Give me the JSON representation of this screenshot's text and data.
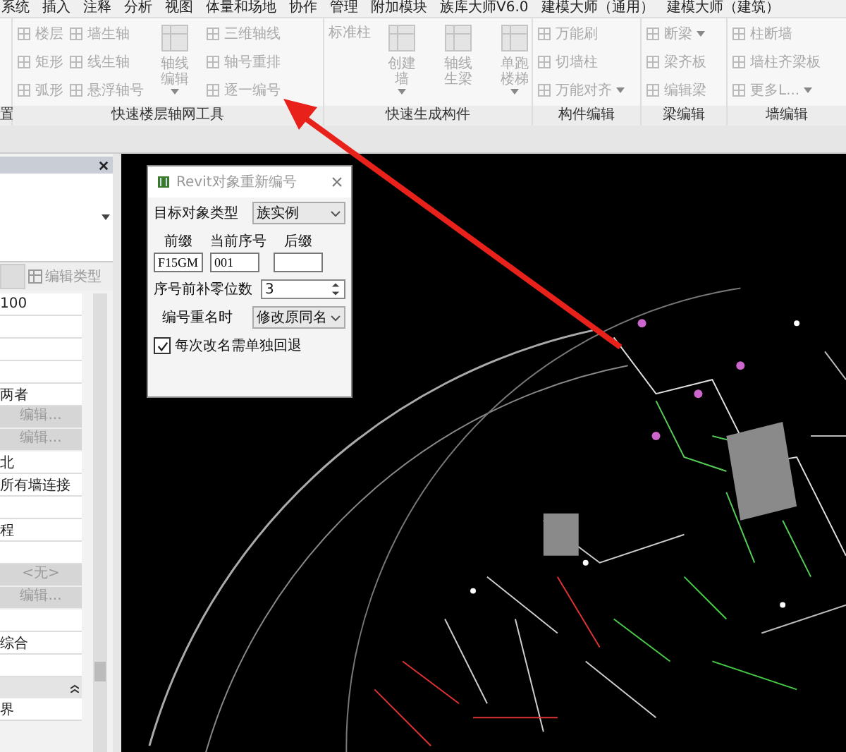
{
  "menu": [
    "系统",
    "插入",
    "注释",
    "分析",
    "视图",
    "体量和场地",
    "协作",
    "管理",
    "附加模块",
    "族库大师V6.0",
    "建模大师（通用）",
    "建模大师（建筑）"
  ],
  "ribbon": {
    "disabled": true,
    "panels": [
      {
        "label": "置"
      },
      {
        "label": "快速楼层轴网工具",
        "columns": [
          [
            {
              "kind": "small",
              "label": "楼层",
              "dropdown": false
            },
            {
              "kind": "small",
              "label": "矩形",
              "dropdown": false
            },
            {
              "kind": "small",
              "label": "弧形",
              "dropdown": false
            }
          ],
          [
            {
              "kind": "small",
              "label": "墙生轴",
              "dropdown": false
            },
            {
              "kind": "small",
              "label": "线生轴",
              "dropdown": false
            },
            {
              "kind": "small",
              "label": "悬浮轴号",
              "dropdown": false
            }
          ],
          [
            {
              "kind": "large",
              "label": "轴线编辑",
              "dropdown": true
            }
          ],
          [
            {
              "kind": "small",
              "label": "三维轴线",
              "dropdown": false
            },
            {
              "kind": "small",
              "label": "轴号重排",
              "dropdown": false
            },
            {
              "kind": "small",
              "label": "逐一编号",
              "dropdown": false
            }
          ]
        ]
      },
      {
        "label": "快速生成构件",
        "columns": [
          [
            {
              "kind": "text",
              "label": "标准柱"
            }
          ],
          [
            {
              "kind": "large",
              "label": "创建墙",
              "dropdown": true
            }
          ],
          [
            {
              "kind": "large",
              "label": "轴线生梁",
              "dropdown": false
            }
          ],
          [
            {
              "kind": "large",
              "label": "单跑楼梯",
              "dropdown": true
            }
          ]
        ]
      },
      {
        "label": "构件编辑",
        "columns": [
          [
            {
              "kind": "small",
              "label": "万能刷",
              "dropdown": false
            },
            {
              "kind": "small",
              "label": "切墙柱",
              "dropdown": false
            },
            {
              "kind": "small",
              "label": "万能对齐",
              "dropdown": true
            }
          ]
        ]
      },
      {
        "label": "梁编辑",
        "columns": [
          [
            {
              "kind": "small",
              "label": "断梁",
              "dropdown": true
            },
            {
              "kind": "small",
              "label": "梁齐板",
              "dropdown": false
            },
            {
              "kind": "small",
              "label": "编辑梁",
              "dropdown": false
            }
          ]
        ]
      },
      {
        "label": "墙编辑",
        "columns": [
          [
            {
              "kind": "small",
              "label": "柱断墙",
              "dropdown": false
            },
            {
              "kind": "small",
              "label": "墙柱齐梁板",
              "dropdown": false
            },
            {
              "kind": "small",
              "label": "更多L...",
              "dropdown": true
            }
          ]
        ]
      }
    ]
  },
  "properties": {
    "edit_type": "编辑类型",
    "rows": [
      {
        "kind": "value",
        "text": "100"
      },
      {
        "kind": "value",
        "text": ""
      },
      {
        "kind": "value",
        "text": ""
      },
      {
        "kind": "value",
        "text": ""
      },
      {
        "kind": "value",
        "text": "两者"
      },
      {
        "kind": "button",
        "text": "编辑..."
      },
      {
        "kind": "button",
        "text": "编辑..."
      },
      {
        "kind": "value",
        "text": "北"
      },
      {
        "kind": "value",
        "text": "所有墙连接"
      },
      {
        "kind": "value",
        "text": ""
      },
      {
        "kind": "value",
        "text": "程"
      },
      {
        "kind": "value",
        "text": ""
      },
      {
        "kind": "button",
        "text": "<无>"
      },
      {
        "kind": "button",
        "text": "编辑..."
      },
      {
        "kind": "value",
        "text": ""
      },
      {
        "kind": "value",
        "text": "综合"
      },
      {
        "kind": "value",
        "text": ""
      },
      {
        "kind": "header",
        "text": ""
      },
      {
        "kind": "value",
        "text": "界"
      }
    ]
  },
  "dialog": {
    "title": "Revit对象重新编号",
    "target_label": "目标对象类型",
    "target_value": "族实例",
    "prefix_label": "前缀",
    "current_label": "当前序号",
    "suffix_label": "后缀",
    "prefix_value": "F15GM",
    "current_value": "001",
    "zero_label": "序号前补零位数",
    "zero_value": "3",
    "dup_label": "编号重名时",
    "dup_value": "修改原同名",
    "undo_label": "每次改名需单独回退",
    "undo_checked": true
  }
}
